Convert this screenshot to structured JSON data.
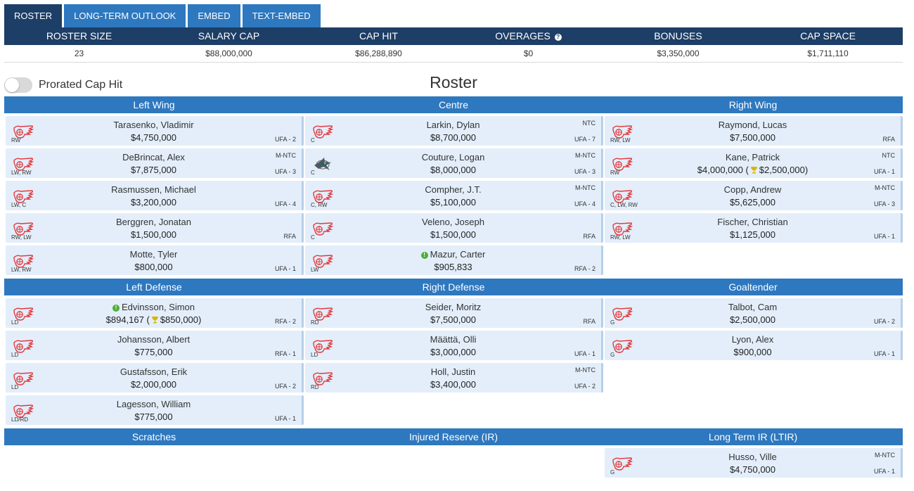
{
  "tabs": [
    "ROSTER",
    "LONG-TERM OUTLOOK",
    "EMBED",
    "TEXT-EMBED"
  ],
  "summary": {
    "headers": [
      "ROSTER SIZE",
      "SALARY CAP",
      "CAP HIT",
      "OVERAGES",
      "BONUSES",
      "CAP SPACE"
    ],
    "values": [
      "23",
      "$88,000,000",
      "$86,288,890",
      "$0",
      "$3,350,000",
      "$1,711,110"
    ]
  },
  "toggle": {
    "label": "Prorated Cap Hit"
  },
  "title": "Roster",
  "sections": {
    "forwards": [
      "Left Wing",
      "Centre",
      "Right Wing"
    ],
    "defense": [
      "Left Defense",
      "Right Defense",
      "Goaltender"
    ],
    "reserve": [
      "Scratches",
      "Injured Reserve (IR)",
      "Long Term IR (LTIR)"
    ]
  },
  "colors": {
    "navy": "#1d3e66",
    "blue": "#2e78bf",
    "card": "#e3eefa",
    "redwings": "#e13a3e",
    "sharks": "#006d75"
  },
  "players": {
    "left_wing": [
      {
        "name": "Tarasenko, Vladimir",
        "salary": "$4,750,000",
        "pos": "RW",
        "clause": "",
        "status": "UFA - 2",
        "logo": "red-wings-logo"
      },
      {
        "name": "DeBrincat, Alex",
        "salary": "$7,875,000",
        "pos": "LW, RW",
        "clause": "M-NTC",
        "status": "UFA - 3",
        "logo": "red-wings-logo"
      },
      {
        "name": "Rasmussen, Michael",
        "salary": "$3,200,000",
        "pos": "LW, C",
        "clause": "",
        "status": "UFA - 4",
        "logo": "red-wings-logo"
      },
      {
        "name": "Berggren, Jonatan",
        "salary": "$1,500,000",
        "pos": "RW, LW",
        "clause": "",
        "status": "RFA",
        "logo": "red-wings-logo"
      },
      {
        "name": "Motte, Tyler",
        "salary": "$800,000",
        "pos": "LW, RW",
        "clause": "",
        "status": "UFA - 1",
        "logo": "red-wings-logo"
      }
    ],
    "centre": [
      {
        "name": "Larkin, Dylan",
        "salary": "$8,700,000",
        "pos": "C",
        "clause": "NTC",
        "status": "UFA - 7",
        "logo": "red-wings-logo"
      },
      {
        "name": "Couture, Logan",
        "salary": "$8,000,000",
        "pos": "C",
        "clause": "M-NTC",
        "status": "UFA - 3",
        "logo": "sharks-logo"
      },
      {
        "name": "Compher, J.T.",
        "salary": "$5,100,000",
        "pos": "C, RW",
        "clause": "M-NTC",
        "status": "UFA - 4",
        "logo": "red-wings-logo"
      },
      {
        "name": "Veleno, Joseph",
        "salary": "$1,500,000",
        "pos": "C",
        "clause": "",
        "status": "RFA",
        "logo": "red-wings-logo"
      },
      {
        "name": "Mazur, Carter",
        "salary": "$905,833",
        "pos": "LW",
        "clause": "",
        "status": "RFA - 2",
        "logo": "red-wings-logo",
        "info": true
      }
    ],
    "right_wing": [
      {
        "name": "Raymond, Lucas",
        "salary": "$7,500,000",
        "pos": "RW, LW",
        "clause": "",
        "status": "RFA",
        "logo": "red-wings-logo"
      },
      {
        "name": "Kane, Patrick",
        "salary": "$4,000,000 (",
        "bonus": "$2,500,000)",
        "pos": "RW",
        "clause": "NTC",
        "status": "UFA - 1",
        "logo": "red-wings-logo"
      },
      {
        "name": "Copp, Andrew",
        "salary": "$5,625,000",
        "pos": "C, LW, RW",
        "clause": "M-NTC",
        "status": "UFA - 3",
        "logo": "red-wings-logo"
      },
      {
        "name": "Fischer, Christian",
        "salary": "$1,125,000",
        "pos": "RW, LW",
        "clause": "",
        "status": "UFA - 1",
        "logo": "red-wings-logo"
      }
    ],
    "left_defense": [
      {
        "name": "Edvinsson, Simon",
        "salary": "$894,167 (",
        "bonus": "$850,000)",
        "pos": "LD",
        "clause": "",
        "status": "RFA - 2",
        "logo": "red-wings-logo",
        "info": true
      },
      {
        "name": "Johansson, Albert",
        "salary": "$775,000",
        "pos": "LD",
        "clause": "",
        "status": "RFA - 1",
        "logo": "red-wings-logo"
      },
      {
        "name": "Gustafsson, Erik",
        "salary": "$2,000,000",
        "pos": "LD",
        "clause": "",
        "status": "UFA - 2",
        "logo": "red-wings-logo"
      },
      {
        "name": "Lagesson, William",
        "salary": "$775,000",
        "pos": "LD/RD",
        "clause": "",
        "status": "UFA - 1",
        "logo": "red-wings-logo"
      }
    ],
    "right_defense": [
      {
        "name": "Seider, Moritz",
        "salary": "$7,500,000",
        "pos": "RD",
        "clause": "",
        "status": "RFA",
        "logo": "red-wings-logo"
      },
      {
        "name": "Määttä, Olli",
        "salary": "$3,000,000",
        "pos": "LD",
        "clause": "",
        "status": "UFA - 1",
        "logo": "red-wings-logo"
      },
      {
        "name": "Holl, Justin",
        "salary": "$3,400,000",
        "pos": "RD",
        "clause": "M-NTC",
        "status": "UFA - 2",
        "logo": "red-wings-logo"
      }
    ],
    "goaltender": [
      {
        "name": "Talbot, Cam",
        "salary": "$2,500,000",
        "pos": "G",
        "clause": "",
        "status": "UFA - 2",
        "logo": "red-wings-logo"
      },
      {
        "name": "Lyon, Alex",
        "salary": "$900,000",
        "pos": "G",
        "clause": "",
        "status": "UFA - 1",
        "logo": "red-wings-logo"
      }
    ],
    "ltir": [
      {
        "name": "Husso, Ville",
        "salary": "$4,750,000",
        "pos": "G",
        "clause": "M-NTC",
        "status": "UFA - 1",
        "logo": "red-wings-logo"
      }
    ]
  }
}
